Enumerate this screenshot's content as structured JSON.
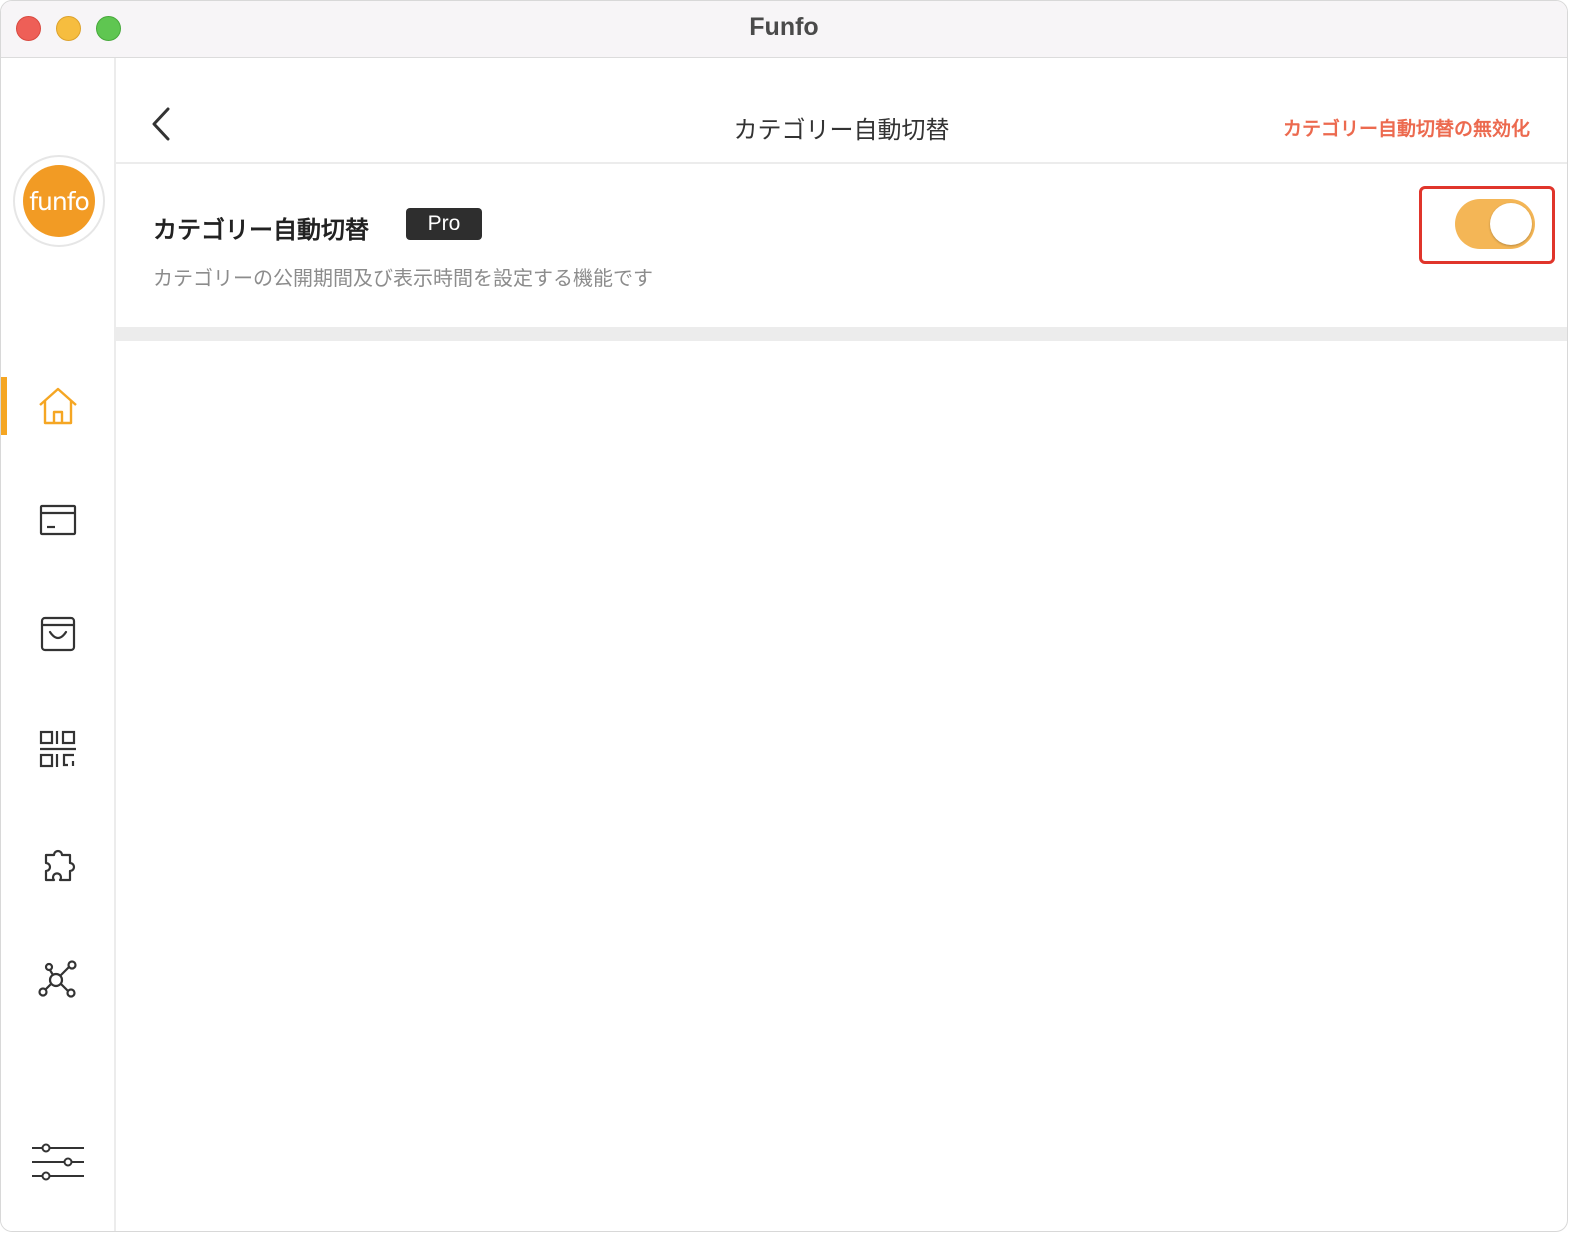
{
  "window": {
    "title": "Funfo"
  },
  "sidebar": {
    "logo_text": "funfo",
    "items": [
      {
        "icon": "home-icon",
        "active": true
      },
      {
        "icon": "card-icon",
        "active": false
      },
      {
        "icon": "shopping-bag-icon",
        "active": false
      },
      {
        "icon": "qr-code-icon",
        "active": false
      },
      {
        "icon": "puzzle-icon",
        "active": false
      },
      {
        "icon": "share-nodes-icon",
        "active": false
      }
    ],
    "bottom_icon": "sliders-icon",
    "accent_color": "#f5a623"
  },
  "header": {
    "title": "カテゴリー自動切替",
    "action_label": "カテゴリー自動切替の無効化",
    "action_color": "#ec6a4f"
  },
  "setting": {
    "title": "カテゴリー自動切替",
    "badge": "Pro",
    "description": "カテゴリーの公開期間及び表示時間を設定する機能です",
    "toggle_on": true,
    "toggle_color": "#f4b656"
  }
}
